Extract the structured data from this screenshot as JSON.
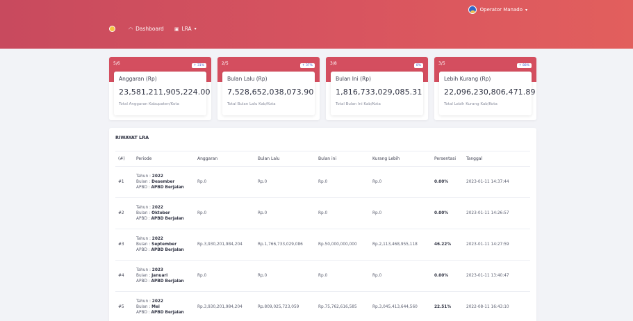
{
  "topbar": {
    "user": "Operator Manado"
  },
  "nav": {
    "dashboard": "Dashboard",
    "lra": "LRA"
  },
  "cards": [
    {
      "count": "5/6",
      "badge": "↑ 31%",
      "title": "Anggaran (Rp)",
      "value": "23,581,211,905,224.00",
      "sub": "Total Anggaran Kabupaten/Kota"
    },
    {
      "count": "2/5",
      "badge": "↑ 37%",
      "title": "Bulan Lalu (Rp)",
      "value": "7,528,652,038,073.90",
      "sub": "Total Bulan Lalu Kab/Kota"
    },
    {
      "count": "3/8",
      "badge": "8%",
      "title": "Bulan Ini (Rp)",
      "value": "1,816,733,029,085.31",
      "sub": "Total Bulan Ini Kab/Kota"
    },
    {
      "count": "3/5",
      "badge": "↑ 88%",
      "title": "Lebih Kurang (Rp)",
      "value": "22,096,230,806,471.89",
      "sub": "Total Lebih Kurang Kab/Kota"
    }
  ],
  "history": {
    "title": "RIWAYAT LRA",
    "columns": [
      "(#)",
      "Periode",
      "Anggaran",
      "Bulan Lalu",
      "Bulan ini",
      "Kurang Lebih",
      "Persentasi",
      "Tanggal"
    ],
    "rows": [
      {
        "no": "#1",
        "tahun": "2022",
        "bulan": "Desember",
        "apbd": "APBD Berjalan",
        "anggaran": "Rp.0",
        "lalu": "Rp.0",
        "ini": "Rp.0",
        "kurang": "Rp.0",
        "persen": "0.00%",
        "tanggal": "2023-01-11 14:37:44"
      },
      {
        "no": "#2",
        "tahun": "2022",
        "bulan": "Oktober",
        "apbd": "APBD Berjalan",
        "anggaran": "Rp.0",
        "lalu": "Rp.0",
        "ini": "Rp.0",
        "kurang": "Rp.0",
        "persen": "0.00%",
        "tanggal": "2023-01-11 14:26:57"
      },
      {
        "no": "#3",
        "tahun": "2022",
        "bulan": "September",
        "apbd": "APBD Berjalan",
        "anggaran": "Rp.3,930,201,984,204",
        "lalu": "Rp.1,766,733,029,086",
        "ini": "Rp.50,000,000,000",
        "kurang": "Rp.2,113,468,955,118",
        "persen": "46.22%",
        "tanggal": "2023-01-11 14:27:59"
      },
      {
        "no": "#4",
        "tahun": "2023",
        "bulan": "Januari",
        "apbd": "APBD Berjalan",
        "anggaran": "Rp.0",
        "lalu": "Rp.0",
        "ini": "Rp.0",
        "kurang": "Rp.0",
        "persen": "0.00%",
        "tanggal": "2023-01-11 13:40:47"
      },
      {
        "no": "#5",
        "tahun": "2022",
        "bulan": "Mei",
        "apbd": "APBD Berjalan",
        "anggaran": "Rp.3,930,201,984,204",
        "lalu": "Rp.809,025,723,059",
        "ini": "Rp.75,762,616,585",
        "kurang": "Rp.3,045,413,644,560",
        "persen": "22.51%",
        "tanggal": "2022-08-11 16:43:10"
      }
    ]
  }
}
